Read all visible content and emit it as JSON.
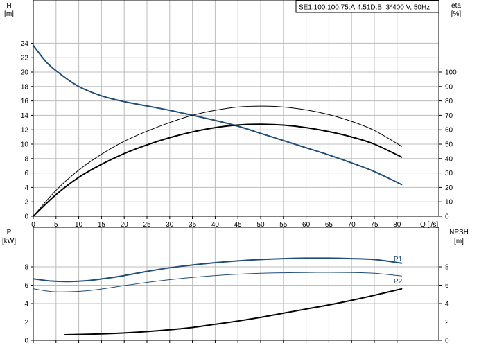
{
  "chart_data": [
    {
      "type": "line",
      "panel": "upper",
      "title": "SE1.100.100.75.A.4.51D.B, 3*400 V, 50Hz",
      "xlabel": "Q [l/s]",
      "ylabel": "H\n[m]",
      "ylabel_parts": [
        "H",
        "[m]"
      ],
      "y2label_parts": [
        "eta",
        "[%]"
      ],
      "xlim": [
        0,
        90
      ],
      "ylim": [
        0,
        28
      ],
      "y2lim": [
        0,
        140
      ],
      "x_ticks": [
        0,
        5,
        10,
        15,
        20,
        25,
        30,
        35,
        40,
        45,
        50,
        55,
        60,
        65,
        70,
        75,
        80
      ],
      "y_ticks": [
        0,
        2,
        4,
        6,
        8,
        10,
        12,
        14,
        16,
        18,
        20,
        22,
        24
      ],
      "y2_ticks": [
        0,
        10,
        20,
        30,
        40,
        50,
        60,
        70,
        80,
        90,
        100
      ],
      "grid": true,
      "series": [
        {
          "axis": "left",
          "color": "#1f4e79",
          "width": 2,
          "x": [
            0,
            3,
            6,
            10,
            15,
            20,
            25,
            30,
            35,
            40,
            45,
            50,
            55,
            60,
            65,
            70,
            75,
            81
          ],
          "y": [
            23.7,
            21.3,
            19.7,
            18.0,
            16.7,
            15.9,
            15.3,
            14.7,
            14.0,
            13.3,
            12.5,
            11.5,
            10.5,
            9.5,
            8.5,
            7.4,
            6.2,
            4.4
          ]
        },
        {
          "axis": "right",
          "color": "#000000",
          "width": 1,
          "x": [
            0,
            5,
            10,
            15,
            20,
            25,
            30,
            35,
            40,
            45,
            50,
            55,
            60,
            65,
            70,
            75,
            81
          ],
          "y": [
            0,
            18,
            32,
            43,
            52,
            59,
            65,
            70,
            73.5,
            75.8,
            76.4,
            75.8,
            73.8,
            70.5,
            65.8,
            59.5,
            48.5
          ]
        },
        {
          "axis": "right",
          "color": "#000000",
          "width": 2,
          "x": [
            0,
            5,
            10,
            15,
            20,
            25,
            30,
            35,
            40,
            45,
            50,
            55,
            60,
            65,
            70,
            75,
            81
          ],
          "y": [
            0,
            15,
            27,
            36,
            43.5,
            49.5,
            54.5,
            58.5,
            61.5,
            63.3,
            63.8,
            63.2,
            61.5,
            58.7,
            55,
            50,
            41
          ]
        }
      ]
    },
    {
      "type": "line",
      "panel": "lower",
      "xlabel": "",
      "ylabel": "P\n[kW]",
      "ylabel_parts": [
        "P",
        "[kW]"
      ],
      "y2label_parts": [
        "NPSH",
        "[m]"
      ],
      "xlim": [
        0,
        90
      ],
      "ylim": [
        0,
        10
      ],
      "y2lim": [
        0,
        10
      ],
      "x_ticks": [
        0,
        5,
        10,
        15,
        20,
        25,
        30,
        35,
        40,
        45,
        50,
        55,
        60,
        65,
        70,
        75,
        80
      ],
      "y_ticks": [
        0,
        2,
        4,
        6,
        8
      ],
      "y2_ticks": [
        0,
        2,
        4,
        6,
        8
      ],
      "grid": true,
      "series": [
        {
          "name": "P1",
          "axis": "left",
          "color": "#1f4e79",
          "width": 2,
          "x": [
            0,
            4,
            8,
            12,
            16,
            20,
            25,
            30,
            35,
            40,
            45,
            50,
            55,
            60,
            65,
            70,
            75,
            81
          ],
          "y": [
            6.7,
            6.45,
            6.4,
            6.5,
            6.75,
            7.05,
            7.5,
            7.9,
            8.2,
            8.45,
            8.65,
            8.8,
            8.9,
            8.95,
            8.95,
            8.9,
            8.8,
            8.4
          ]
        },
        {
          "name": "P2",
          "axis": "left",
          "color": "#1f4e79",
          "width": 1,
          "x": [
            0,
            4,
            8,
            12,
            16,
            20,
            25,
            30,
            35,
            40,
            45,
            50,
            55,
            60,
            65,
            70,
            75,
            81
          ],
          "y": [
            5.6,
            5.3,
            5.28,
            5.4,
            5.65,
            5.95,
            6.3,
            6.6,
            6.85,
            7.05,
            7.2,
            7.3,
            7.35,
            7.38,
            7.4,
            7.38,
            7.3,
            7.0
          ]
        },
        {
          "axis": "right",
          "color": "#000000",
          "width": 2,
          "x": [
            7,
            15,
            20,
            25,
            30,
            35,
            40,
            45,
            50,
            55,
            60,
            65,
            70,
            75,
            81
          ],
          "y": [
            0.6,
            0.7,
            0.8,
            0.95,
            1.15,
            1.4,
            1.75,
            2.1,
            2.5,
            2.95,
            3.4,
            3.85,
            4.35,
            4.9,
            5.6
          ]
        }
      ],
      "annotations": [
        "P1",
        "P2"
      ]
    }
  ]
}
